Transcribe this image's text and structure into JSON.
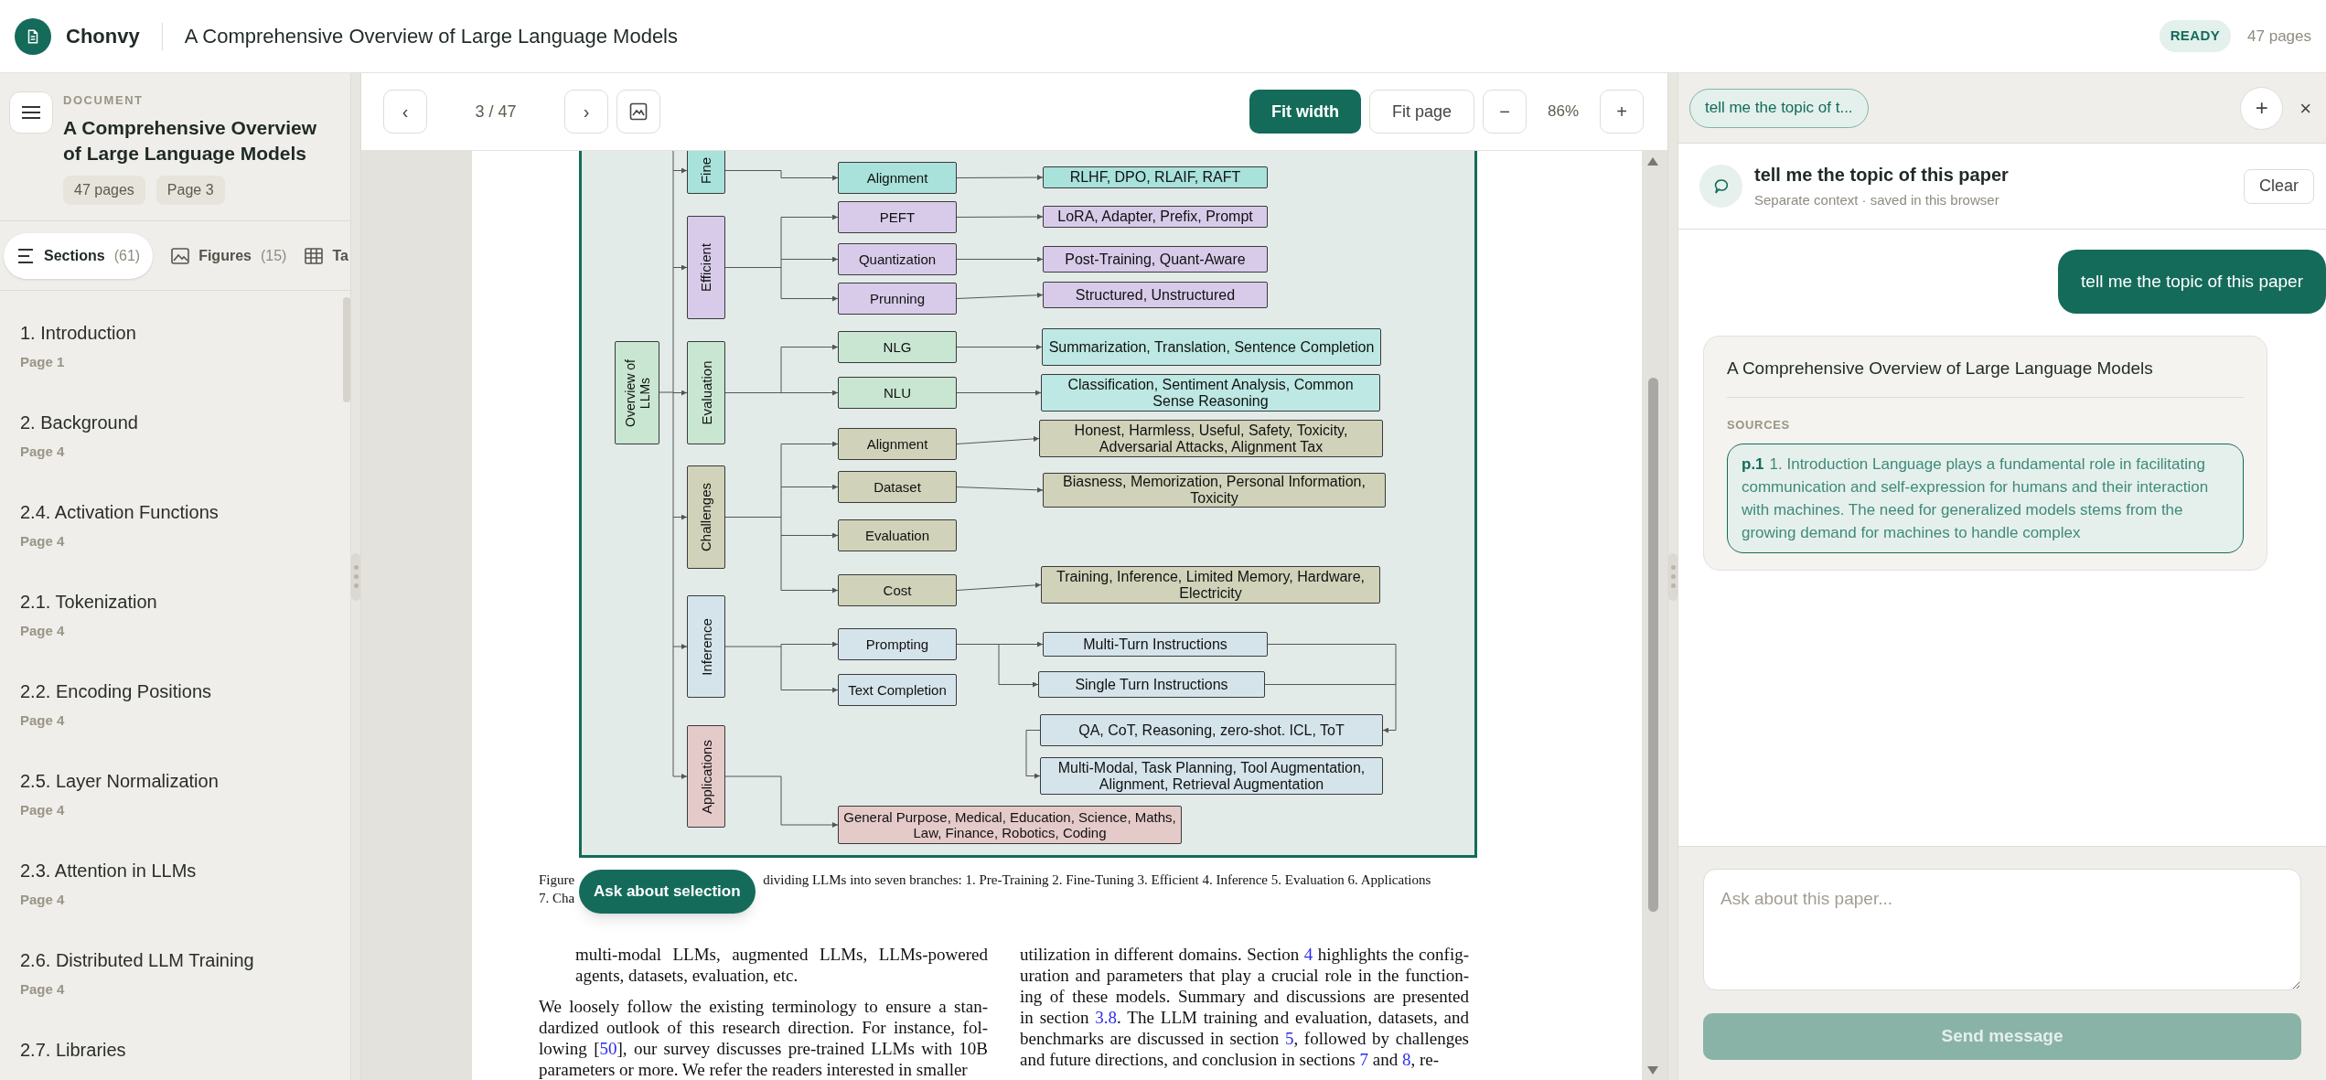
{
  "app": {
    "name": "Chonvy",
    "document_title": "A Comprehensive Overview of Large Language Models",
    "status": "READY",
    "page_count": "47 pages"
  },
  "sidebar": {
    "label": "DOCUMENT",
    "title": "A Comprehensive Overview of Large Language Models",
    "chips": [
      "47 pages",
      "Page 3"
    ],
    "tabs": [
      {
        "label": "Sections",
        "count": "(61)",
        "selected": true,
        "kind": "sections"
      },
      {
        "label": "Figures",
        "count": "(15)",
        "selected": false,
        "kind": "figures"
      },
      {
        "label": "Ta",
        "selected": false,
        "kind": "tables"
      }
    ],
    "sections": [
      {
        "title": "1. Introduction",
        "page": "Page 1"
      },
      {
        "title": "2. Background",
        "page": "Page 4"
      },
      {
        "title": "2.4. Activation Functions",
        "page": "Page 4"
      },
      {
        "title": "2.1. Tokenization",
        "page": "Page 4"
      },
      {
        "title": "2.2. Encoding Positions",
        "page": "Page 4"
      },
      {
        "title": "2.5. Layer Normalization",
        "page": "Page 4"
      },
      {
        "title": "2.3. Attention in LLMs",
        "page": "Page 4"
      },
      {
        "title": "2.6. Distributed LLM Training",
        "page": "Page 4"
      },
      {
        "title": "2.7. Libraries"
      }
    ]
  },
  "viewer": {
    "prev": "‹",
    "page_indicator": "3 / 47",
    "next": "›",
    "fit_width": {
      "label": "Fit width",
      "selected": true
    },
    "fit_page": {
      "label": "Fit page",
      "selected": false
    },
    "zoom_out": "−",
    "zoom": "86%",
    "zoom_in": "+",
    "figure": {
      "root": "Overview of LLMs",
      "branches": [
        {
          "label": "Fine",
          "color": "#a8e2da",
          "nodes": [
            {
              "label": "Alignment",
              "leaves": [
                {
                  "label": "RLHF, DPO, RLAIF, RAFT",
                  "color": "#a8e2da"
                }
              ]
            }
          ]
        },
        {
          "label": "Efficient",
          "color": "#d8cbea",
          "nodes": [
            {
              "label": "PEFT",
              "leaves": [
                {
                  "label": "LoRA, Adapter, Prefix, Prompt",
                  "color": "#d8cbea"
                }
              ]
            },
            {
              "label": "Quantization",
              "leaves": [
                {
                  "label": "Post-Training, Quant-Aware",
                  "color": "#d8cbea"
                }
              ]
            },
            {
              "label": "Prunning",
              "leaves": [
                {
                  "label": "Structured, Unstructured",
                  "color": "#d8cbea"
                }
              ]
            }
          ]
        },
        {
          "label": "Evaluation",
          "color": "#c8e6d1",
          "nodes": [
            {
              "label": "NLG",
              "leaves": [
                {
                  "label": "Summarization, Translation, Sentence Completion",
                  "color": "#bde8e3"
                }
              ]
            },
            {
              "label": "NLU",
              "leaves": [
                {
                  "label": "Classification, Sentiment Analysis, Common Sense Reasoning",
                  "color": "#bde8e3"
                }
              ]
            }
          ]
        },
        {
          "label": "Challenges",
          "color": "#d0d3b9",
          "nodes": [
            {
              "label": "Alignment",
              "leaves": [
                {
                  "label": "Honest, Harmless, Useful, Safety, Toxicity, Adversarial Attacks, Alignment Tax",
                  "color": "#d0d3b9"
                }
              ]
            },
            {
              "label": "Dataset",
              "leaves": [
                {
                  "label": "Biasness, Memorization, Personal Information, Toxicity",
                  "color": "#d0d3b9"
                }
              ]
            },
            {
              "label": "Evaluation"
            },
            {
              "label": "Cost",
              "leaves": [
                {
                  "label": "Training, Inference, Limited Memory, Hardware, Electricity",
                  "color": "#d0d3b9"
                }
              ]
            }
          ]
        },
        {
          "label": "Inference",
          "color": "#d5e4eb",
          "nodes": [
            {
              "label": "Prompting",
              "leaves": [
                {
                  "label": "Multi-Turn Instructions",
                  "color": "#d5e4eb"
                },
                {
                  "label": "Single Turn Instructions",
                  "color": "#d5e4eb"
                },
                {
                  "label": "QA, CoT, Reasoning, zero-shot. ICL, ToT",
                  "color": "#d5e4eb"
                },
                {
                  "label": "Multi-Modal, Task Planning, Tool Augmentation, Alignment, Retrieval Augmentation",
                  "color": "#d5e4eb"
                }
              ]
            },
            {
              "label": "Text Completion"
            }
          ]
        },
        {
          "label": "Applications",
          "color": "#e5caca",
          "nodes": [
            {
              "label": "General Purpose, Medical, Education, Science, Maths, Law, Finance, Robotics, Coding"
            }
          ]
        }
      ]
    },
    "caption": [
      "Figure",
      "dividing LLMs into seven branches: 1. Pre-Training 2. Fine-Tuning 3. Efficient 4. Inference 5. Evaluation 6. Applications",
      "7. Cha"
    ],
    "ask_selection": "Ask about selection",
    "columns": [
      [
        {
          "indent": true,
          "lines": [
            [
              {
                "text": "multi-modal LLMs, augmented LLMs, LLMs-powered"
              }
            ],
            [
              {
                "text": "agents, datasets, evaluation, etc."
              }
            ]
          ]
        },
        {
          "indent": false,
          "lines": [
            [
              {
                "text": "We loosely follow the existing terminology to ensure a stan-"
              }
            ],
            [
              {
                "text": "dardized outlook of this research direction. For instance, fol-"
              }
            ],
            [
              {
                "text": "lowing ["
              },
              {
                "text": "50",
                "kind": "link"
              },
              {
                "text": "], our survey discusses pre-trained LLMs with 10B"
              }
            ],
            [
              {
                "text": "parameters or more. We refer the readers interested in smaller"
              }
            ]
          ]
        }
      ],
      [
        {
          "indent": false,
          "lines": [
            [
              {
                "text": "utilization in different domains. Section "
              },
              {
                "text": "4",
                "kind": "link"
              },
              {
                "text": " highlights the config-"
              }
            ],
            [
              {
                "text": "uration and parameters that play a crucial role in the function-"
              }
            ],
            [
              {
                "text": "ing of these models. Summary and discussions are presented"
              }
            ],
            [
              {
                "text": "in section "
              },
              {
                "text": "3.8",
                "kind": "link"
              },
              {
                "text": ". The LLM training and evaluation, datasets, and"
              }
            ],
            [
              {
                "text": "benchmarks are discussed in section "
              },
              {
                "text": "5",
                "kind": "link"
              },
              {
                "text": ", followed by challenges"
              }
            ],
            [
              {
                "text": "and future directions, and conclusion in sections "
              },
              {
                "text": "7",
                "kind": "link"
              },
              {
                "text": " and "
              },
              {
                "text": "8",
                "kind": "link"
              },
              {
                "text": ", re-"
              }
            ]
          ]
        }
      ]
    ]
  },
  "chat": {
    "tab": "tell me the topic of t...",
    "new_tab": "+",
    "close": "×",
    "title": "tell me the topic of this paper",
    "subtitle": "Separate context · saved in this browser",
    "clear": "Clear",
    "messages": [
      {
        "kind": "user",
        "text": "tell me the topic of this paper"
      },
      {
        "kind": "assistant",
        "text": "A Comprehensive Overview of Large Language Models",
        "sources_label": "SOURCES",
        "sources": [
          {
            "page": "p.1",
            "text": "1. Introduction Language plays a fundamental role in facilitating communication and self-expression for humans and their interaction with machines. The need for generalized models stems from the growing demand for machines to handle complex"
          }
        ]
      }
    ],
    "placeholder": "Ask about this paper...",
    "send": "Send message",
    "send_disabled": true
  }
}
